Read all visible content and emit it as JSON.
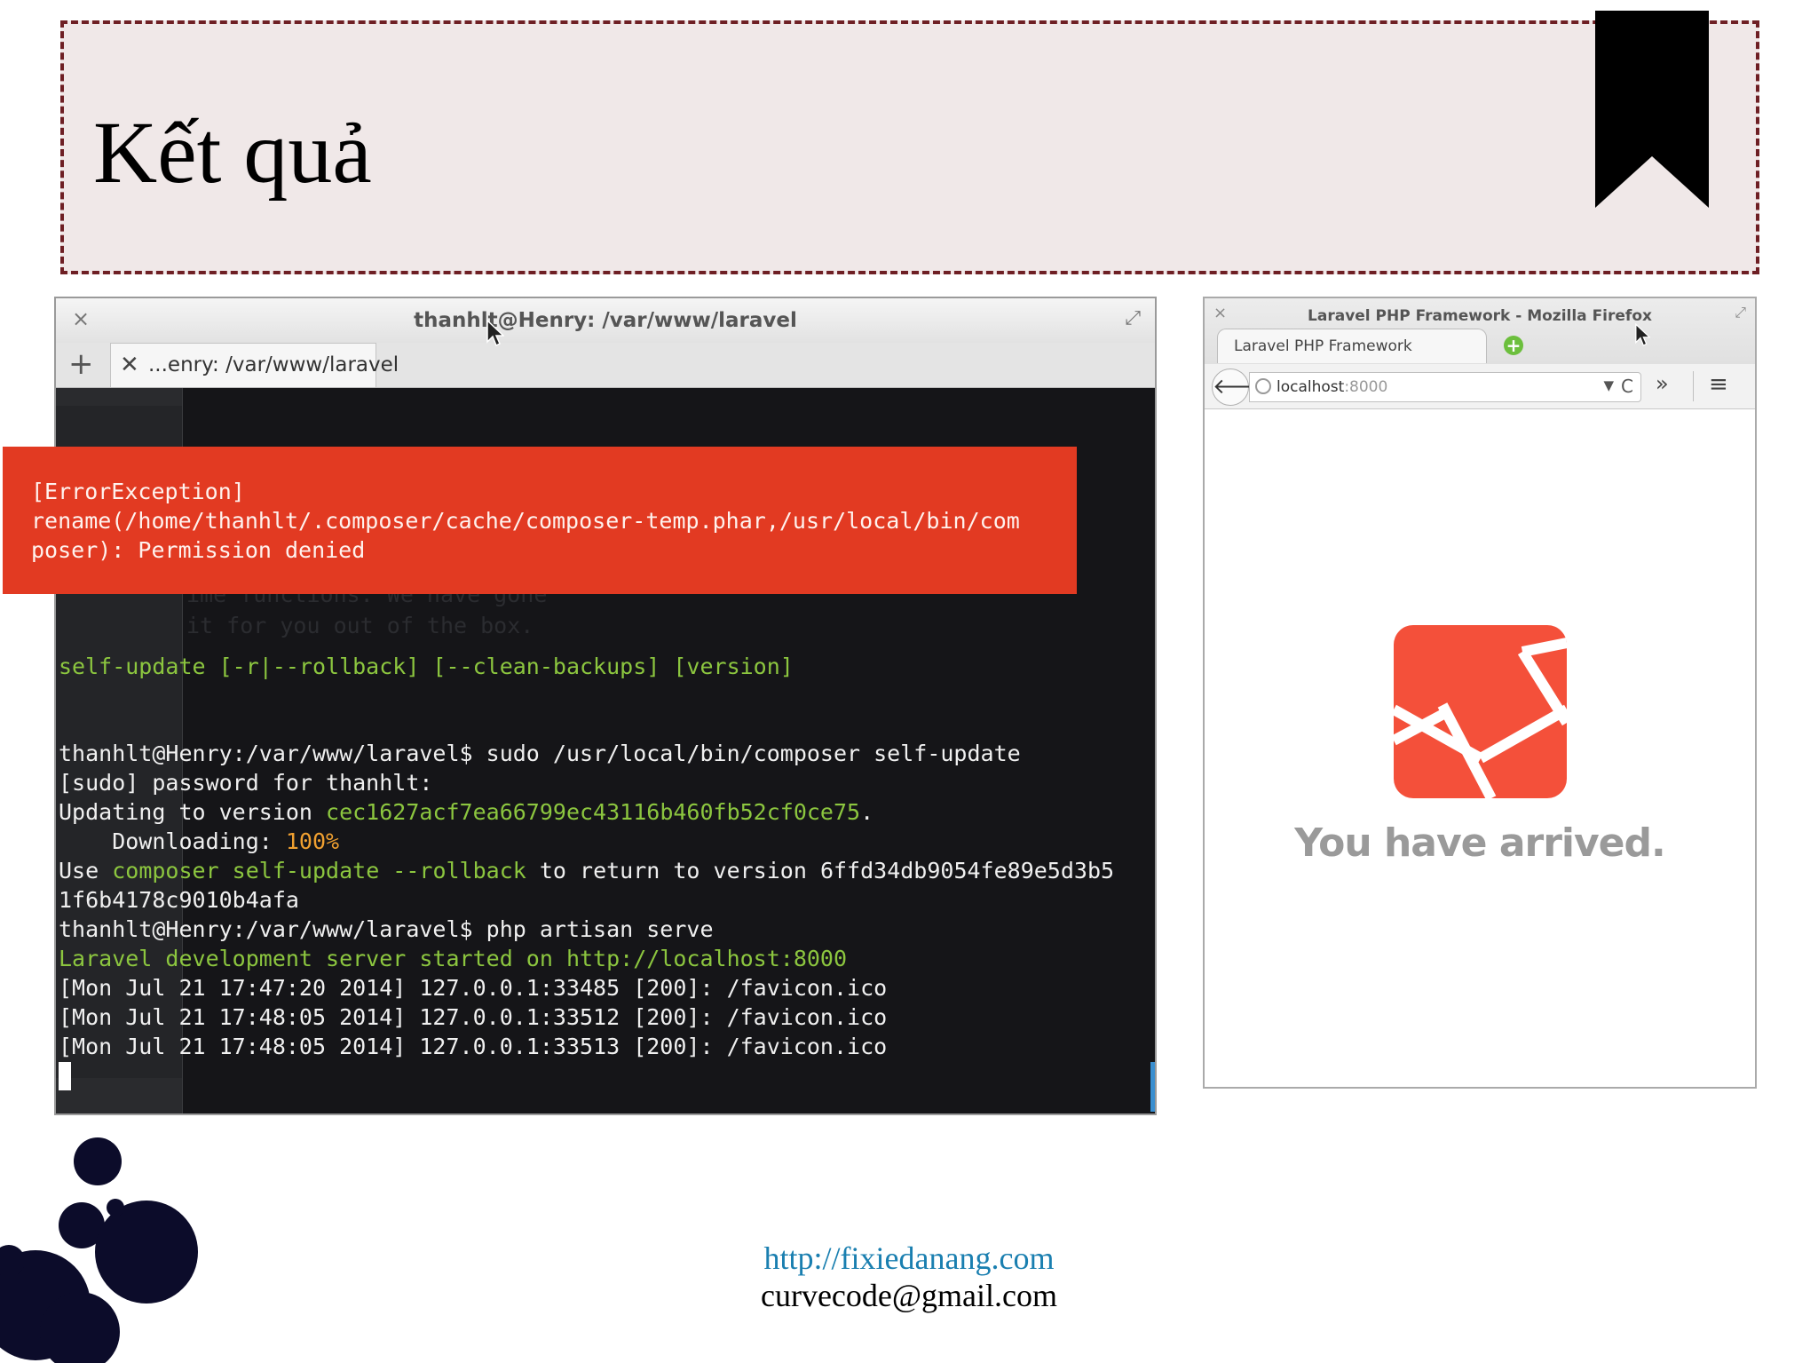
{
  "slide": {
    "title": "Kết quả",
    "footer_url": "http://fixiedanang.com",
    "footer_email": "curvecode@gmail.com"
  },
  "terminal": {
    "window_title": "thanhlt@Henry: /var/www/laravel",
    "new_tab_glyph": "+",
    "close_glyph": "×",
    "tab_close_glyph": "✕",
    "maximize_glyph": "⤢",
    "tab_label": "...enry: /var/www/laravel",
    "error": {
      "line1": "[ErrorException]",
      "line2": "rename(/home/thanhlt/.composer/cache/composer-temp.phar,/usr/local/bin/com",
      "line3": "poser): Permission denied"
    },
    "ghost_lines": {
      "g1": "ime functions. We have gone",
      "g2": "it for you out of the box."
    },
    "lines": {
      "l1": "self-update [-r|--rollback] [--clean-backups] [version]",
      "l2": "thanhlt@Henry:/var/www/laravel$ sudo /usr/local/bin/composer self-update",
      "l3": "[sudo] password for thanhlt:",
      "l4a": "Updating to version ",
      "l4b": "cec1627acf7ea66799ec43116b460fb52cf0ce75",
      "l4c": ".",
      "l5a": "    Downloading: ",
      "l5b": "100%",
      "l6a": "Use ",
      "l6b": "composer self-update --rollback",
      "l6c": " to return to version 6ffd34db9054fe89e5d3b5",
      "l7": "1f6b4178c9010b4afa",
      "l8": "thanhlt@Henry:/var/www/laravel$ php artisan serve",
      "l9": "Laravel development server started on http://localhost:8000",
      "l10": "[Mon Jul 21 17:47:20 2014] 127.0.0.1:33485 [200]: /favicon.ico",
      "l11": "[Mon Jul 21 17:48:05 2014] 127.0.0.1:33512 [200]: /favicon.ico",
      "l12": "[Mon Jul 21 17:48:05 2014] 127.0.0.1:33513 [200]: /favicon.ico"
    }
  },
  "browser": {
    "window_title": "Laravel PHP Framework - Mozilla Firefox",
    "close_glyph": "×",
    "maximize_glyph": "⤢",
    "tab_label": "Laravel PHP Framework",
    "new_tab_glyph": "+",
    "back_glyph": "🡐",
    "url_host": "localhost",
    "url_port": ":8000",
    "dropdown_glyph": "▼",
    "reload_glyph": "C",
    "overflow_glyph": "»",
    "menu_glyph": "≡",
    "page_message": "You have arrived."
  },
  "colors": {
    "title_border": "#6e1f24",
    "title_background": "#f0e8e8",
    "error_background": "#e23a22",
    "terminal_green": "#8cc63f",
    "laravel_red": "#f4503a",
    "link": "#1a7fb0"
  },
  "icons": [
    "bookmark-icon",
    "plus-icon",
    "close-icon",
    "maximize-icon",
    "globe-icon",
    "back-arrow-icon",
    "reload-icon",
    "menu-icon",
    "laravel-logo-icon",
    "mouse-cursor-icon"
  ]
}
